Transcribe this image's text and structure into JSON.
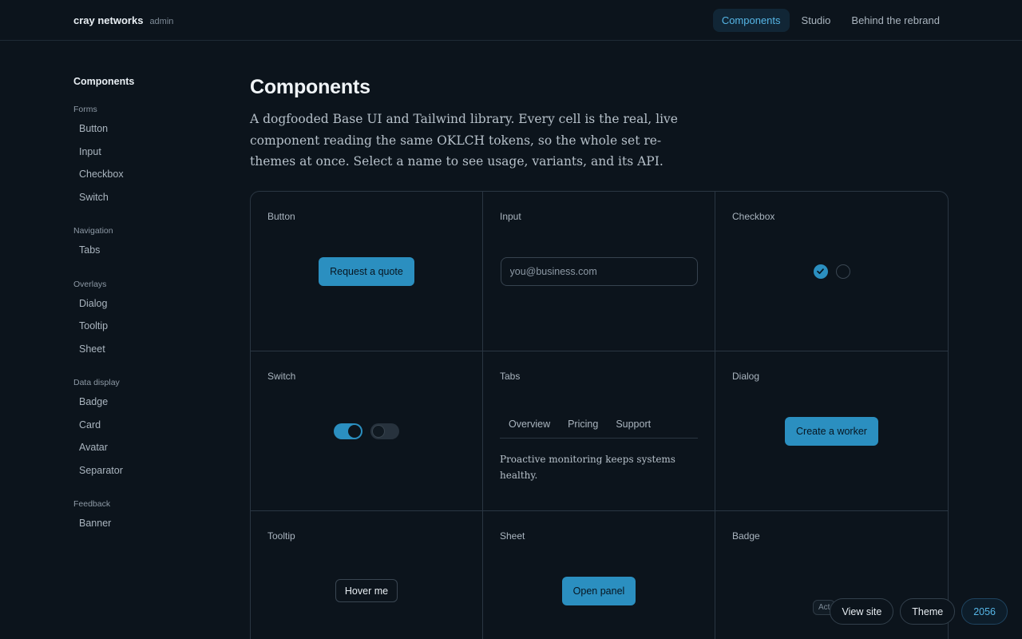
{
  "header": {
    "brand": "cray networks",
    "role": "admin",
    "nav": [
      {
        "label": "Components",
        "active": true
      },
      {
        "label": "Studio",
        "active": false
      },
      {
        "label": "Behind the rebrand",
        "active": false
      }
    ]
  },
  "sidebar": {
    "title": "Components",
    "groups": [
      {
        "label": "Forms",
        "items": [
          "Button",
          "Input",
          "Checkbox",
          "Switch"
        ]
      },
      {
        "label": "Navigation",
        "items": [
          "Tabs"
        ]
      },
      {
        "label": "Overlays",
        "items": [
          "Dialog",
          "Tooltip",
          "Sheet"
        ]
      },
      {
        "label": "Data display",
        "items": [
          "Badge",
          "Card",
          "Avatar",
          "Separator"
        ]
      },
      {
        "label": "Feedback",
        "items": [
          "Banner"
        ]
      }
    ]
  },
  "main": {
    "title": "Components",
    "description": "A dogfooded Base UI and Tailwind library. Every cell is the real, live component reading the same OKLCH tokens, so the whole set re-themes at once. Select a name to see usage, variants, and its API.",
    "cells": {
      "button": {
        "title": "Button",
        "label": "Request a quote"
      },
      "input": {
        "title": "Input",
        "placeholder": "you@business.com"
      },
      "checkbox": {
        "title": "Checkbox",
        "states": [
          "checked",
          "unchecked"
        ]
      },
      "switch": {
        "title": "Switch",
        "states": [
          "on",
          "off"
        ]
      },
      "tabs": {
        "title": "Tabs",
        "tabs": [
          "Overview",
          "Pricing",
          "Support"
        ],
        "panel": "Proactive monitoring keeps systems healthy."
      },
      "dialog": {
        "title": "Dialog",
        "label": "Create a worker"
      },
      "tooltip": {
        "title": "Tooltip",
        "label": "Hover me"
      },
      "sheet": {
        "title": "Sheet",
        "label": "Open panel"
      },
      "badge": {
        "title": "Badge",
        "label": "Act"
      }
    }
  },
  "floaters": {
    "view_site": "View site",
    "theme": "Theme",
    "year": "2056"
  },
  "colors": {
    "background": "#0c141c",
    "accent": "#2b8fc0",
    "accent_text": "#56b6e6",
    "border": "#2a3642"
  },
  "icons": {
    "check": "check-icon"
  }
}
